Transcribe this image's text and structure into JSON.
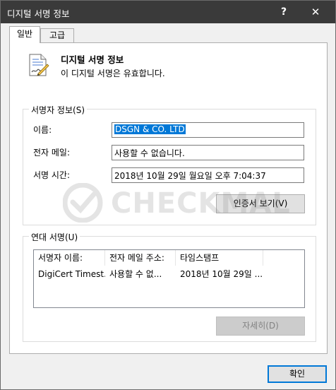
{
  "window": {
    "title": "디지털 서명 정보",
    "help": "?",
    "close": "✕"
  },
  "tabs": [
    {
      "label": "일반",
      "active": true
    },
    {
      "label": "고급",
      "active": false
    }
  ],
  "header": {
    "title": "디지털 서명 정보",
    "subtitle": "이 디지털 서명은 유효합니다."
  },
  "signer": {
    "group_label": "서명자 정보(S)",
    "name_label": "이름:",
    "name_value": "DSGN & CO. LTD",
    "email_label": "전자 메일:",
    "email_value": "사용할 수 없습니다.",
    "time_label": "서명 시간:",
    "time_value": "2018년 10월 29일 월요일 오후 7:04:37",
    "view_cert_button": "인증서 보기(V)"
  },
  "countersignatures": {
    "group_label": "연대 서명(U)",
    "columns": [
      "서명자 이름:",
      "전자 메일 주소:",
      "타임스탬프"
    ],
    "rows": [
      [
        "DigiCert Timest...",
        "사용할 수 없...",
        "2018년 10월 29일 ..."
      ]
    ],
    "details_button": "자세히(D)"
  },
  "watermark": {
    "text": "CHECKMAL"
  },
  "ok_button": "확인",
  "colors": {
    "titlebar": "#3a3a3a",
    "selection": "#0078d7",
    "accent": "#0078d7"
  }
}
